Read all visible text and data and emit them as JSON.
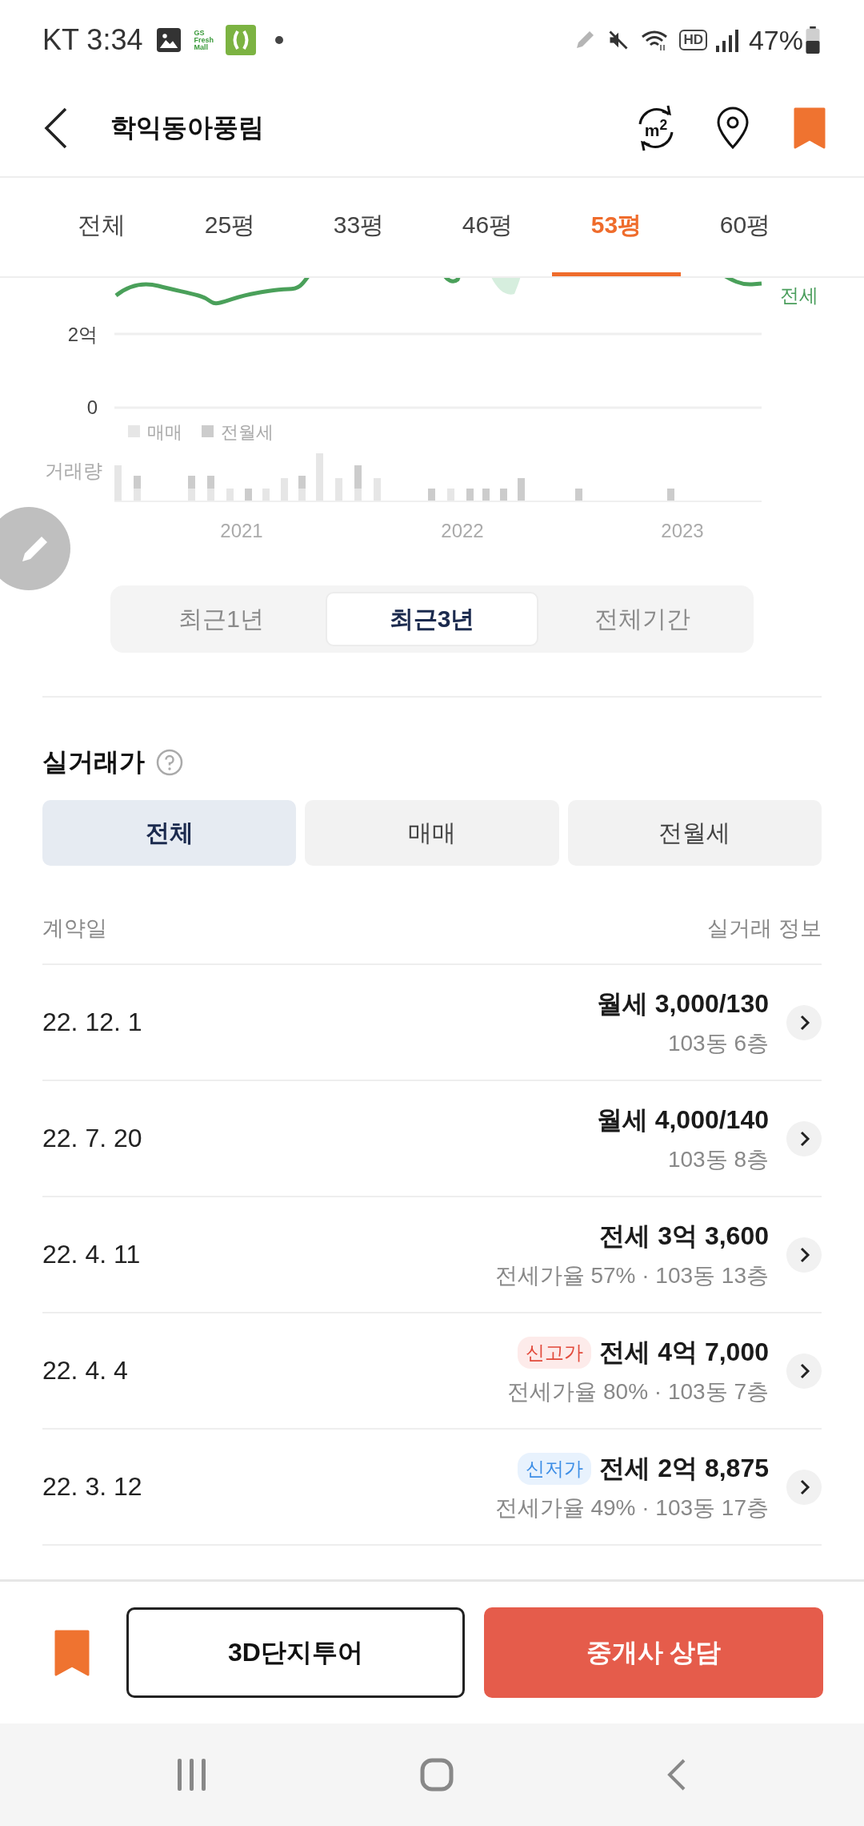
{
  "status_bar": {
    "carrier_time": "KT 3:34",
    "app_icon_text": "GS Fresh Mall",
    "hd_label": "HD",
    "battery": "47%"
  },
  "header": {
    "title": "학익동아풍림",
    "unit_toggle": "m$^{2}$",
    "bookmarked": true
  },
  "size_tabs": [
    {
      "label": "전체",
      "selected": false
    },
    {
      "label": "25평",
      "selected": false
    },
    {
      "label": "33평",
      "selected": false
    },
    {
      "label": "46평",
      "selected": false
    },
    {
      "label": "53평",
      "selected": true
    },
    {
      "label": "60평",
      "selected": false
    }
  ],
  "chart": {
    "line_label": "전세",
    "y_labels": [
      "2억",
      "0"
    ],
    "legend": [
      {
        "label": "매매",
        "kind": "sale"
      },
      {
        "label": "전월세",
        "kind": "rent"
      }
    ],
    "volume_label": "거래량",
    "x_labels": [
      "2021",
      "2022",
      "2023"
    ]
  },
  "period_tabs": [
    {
      "label": "최근1년",
      "selected": false
    },
    {
      "label": "최근3년",
      "selected": true
    },
    {
      "label": "전체기간",
      "selected": false
    }
  ],
  "transactions": {
    "title": "실거래가",
    "filters": [
      {
        "label": "전체",
        "selected": true
      },
      {
        "label": "매매",
        "selected": false
      },
      {
        "label": "전월세",
        "selected": false
      }
    ],
    "columns": [
      "계약일",
      "실거래 정보"
    ],
    "rows": [
      {
        "date": "22. 12. 1",
        "price": "월세 3,000/130",
        "detail": "103동 6층"
      },
      {
        "date": "22. 7. 20",
        "price": "월세 4,000/140",
        "detail": "103동 8층"
      },
      {
        "date": "22. 4. 11",
        "price": "전세 3억 3,600",
        "detail": "전세가율 57% · 103동 13층"
      },
      {
        "date": "22. 4. 4",
        "badge": {
          "kind": "high",
          "label": "신고가"
        },
        "price": "전세 4억 7,000",
        "detail": "전세가율 80% · 103동 7층"
      },
      {
        "date": "22. 3. 12",
        "badge": {
          "kind": "low",
          "label": "신저가"
        },
        "price": "전세 2억 8,875",
        "detail": "전세가율 49% · 103동 17층"
      }
    ]
  },
  "bottom_bar": {
    "bookmarked": true,
    "tour_button": "3D단지투어",
    "contact_button": "중개사 상담"
  }
}
